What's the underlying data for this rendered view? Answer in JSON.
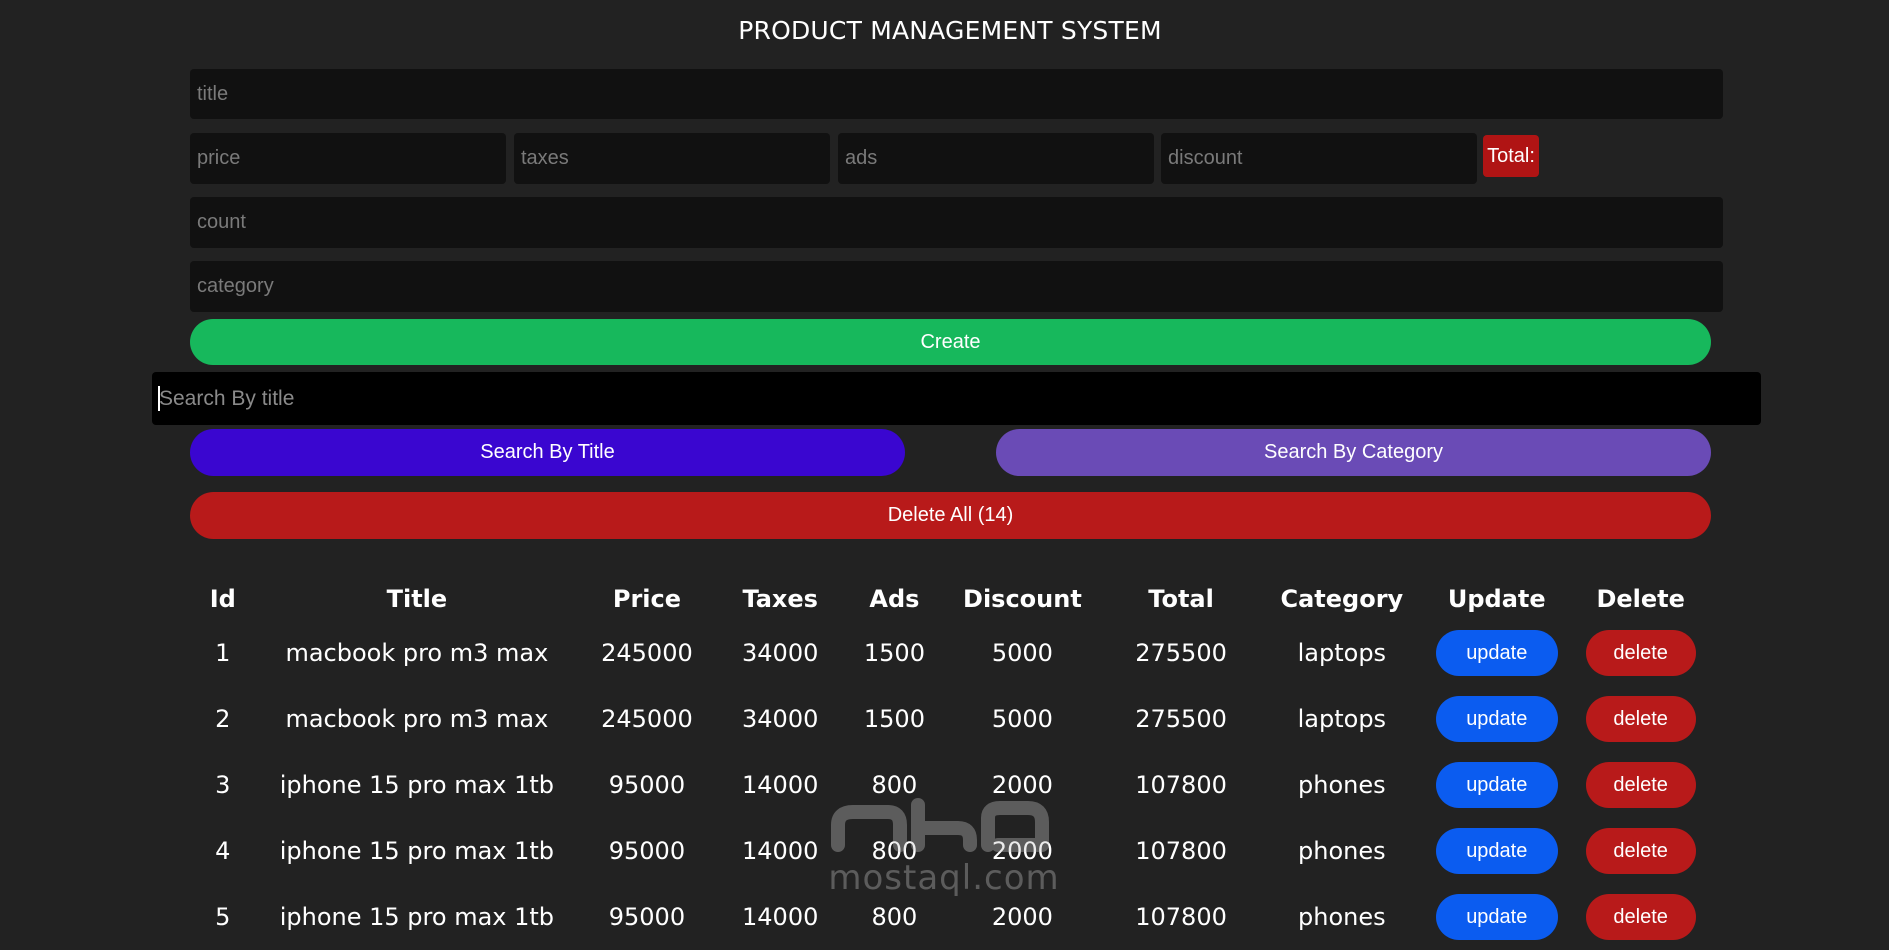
{
  "header": {
    "title": "PRODUCT MANAGEMENT SYSTEM"
  },
  "form": {
    "title_placeholder": "title",
    "price_placeholder": "price",
    "taxes_placeholder": "taxes",
    "ads_placeholder": "ads",
    "discount_placeholder": "discount",
    "total_label": "Total:",
    "count_placeholder": "count",
    "category_placeholder": "category",
    "create_label": "Create"
  },
  "search": {
    "placeholder": "Search By title",
    "by_title_label": "Search By Title",
    "by_category_label": "Search By Category"
  },
  "delete_all_label": "Delete All (14)",
  "table": {
    "headers": [
      "Id",
      "Title",
      "Price",
      "Taxes",
      "Ads",
      "Discount",
      "Total",
      "Category",
      "Update",
      "Delete"
    ],
    "rows": [
      {
        "id": "1",
        "title": "macbook pro m3 max",
        "price": "245000",
        "taxes": "34000",
        "ads": "1500",
        "discount": "5000",
        "total": "275500",
        "category": "laptops",
        "update": "update",
        "delete": "delete"
      },
      {
        "id": "2",
        "title": "macbook pro m3 max",
        "price": "245000",
        "taxes": "34000",
        "ads": "1500",
        "discount": "5000",
        "total": "275500",
        "category": "laptops",
        "update": "update",
        "delete": "delete"
      },
      {
        "id": "3",
        "title": "iphone 15 pro max 1tb",
        "price": "95000",
        "taxes": "14000",
        "ads": "800",
        "discount": "2000",
        "total": "107800",
        "category": "phones",
        "update": "update",
        "delete": "delete"
      },
      {
        "id": "4",
        "title": "iphone 15 pro max 1tb",
        "price": "95000",
        "taxes": "14000",
        "ads": "800",
        "discount": "2000",
        "total": "107800",
        "category": "phones",
        "update": "update",
        "delete": "delete"
      },
      {
        "id": "5",
        "title": "iphone 15 pro max 1tb",
        "price": "95000",
        "taxes": "14000",
        "ads": "800",
        "discount": "2000",
        "total": "107800",
        "category": "phones",
        "update": "update",
        "delete": "delete"
      }
    ]
  },
  "watermark": {
    "arabic": "مستقل",
    "latin": "mostaql.com"
  },
  "colors": {
    "background": "#222222",
    "input_bg": "#111111",
    "create": "#17b85c",
    "search_title": "#3a06d0",
    "search_category": "#6a4bb6",
    "danger": "#b81a1a",
    "update": "#0b5cf0"
  }
}
